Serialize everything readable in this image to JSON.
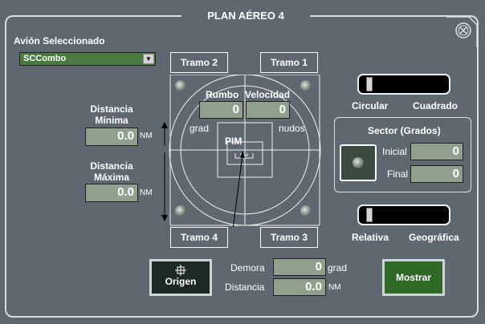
{
  "title": "PLAN AÉREO 4",
  "aircraft": {
    "label": "Avión Seleccionado",
    "selected": "SCCombo"
  },
  "buttons": {
    "tramo1": "Tramo 1",
    "tramo2": "Tramo 2",
    "tramo3": "Tramo 3",
    "tramo4": "Tramo 4",
    "origen": "Origen",
    "mostrar": "Mostrar"
  },
  "rumbo": {
    "label": "Rumbo",
    "value": "0",
    "unit": "grad"
  },
  "velocidad": {
    "label": "Velocidad",
    "value": "0",
    "unit": "nudos"
  },
  "pim": "PIM",
  "dist_min": {
    "label_1": "Distancia",
    "label_2": "Mínima",
    "value": "0.0",
    "unit": "NM"
  },
  "dist_max": {
    "label_1": "Distancia",
    "label_2": "Máxima",
    "value": "0.0",
    "unit": "NM"
  },
  "mode_slider": {
    "left": "Circular",
    "right": "Cuadrado",
    "position": 0
  },
  "sector": {
    "title": "Sector  (Grados)",
    "inicial_label": "Inicial",
    "inicial_value": "0",
    "final_label": "Final",
    "final_value": "0"
  },
  "ref_slider": {
    "left": "Relativa",
    "right": "Geográfica",
    "position": 0
  },
  "demora": {
    "label": "Demora",
    "value": "0",
    "unit": "grad"
  },
  "distancia": {
    "label": "Distancia",
    "value": "0.0",
    "unit": "NM"
  },
  "colors": {
    "background": "#5f6870",
    "field": "#8fa08c",
    "mostrar": "#2e6a26"
  },
  "icons": {
    "close": "close-x-icon",
    "origen": "crosshair-icon"
  }
}
